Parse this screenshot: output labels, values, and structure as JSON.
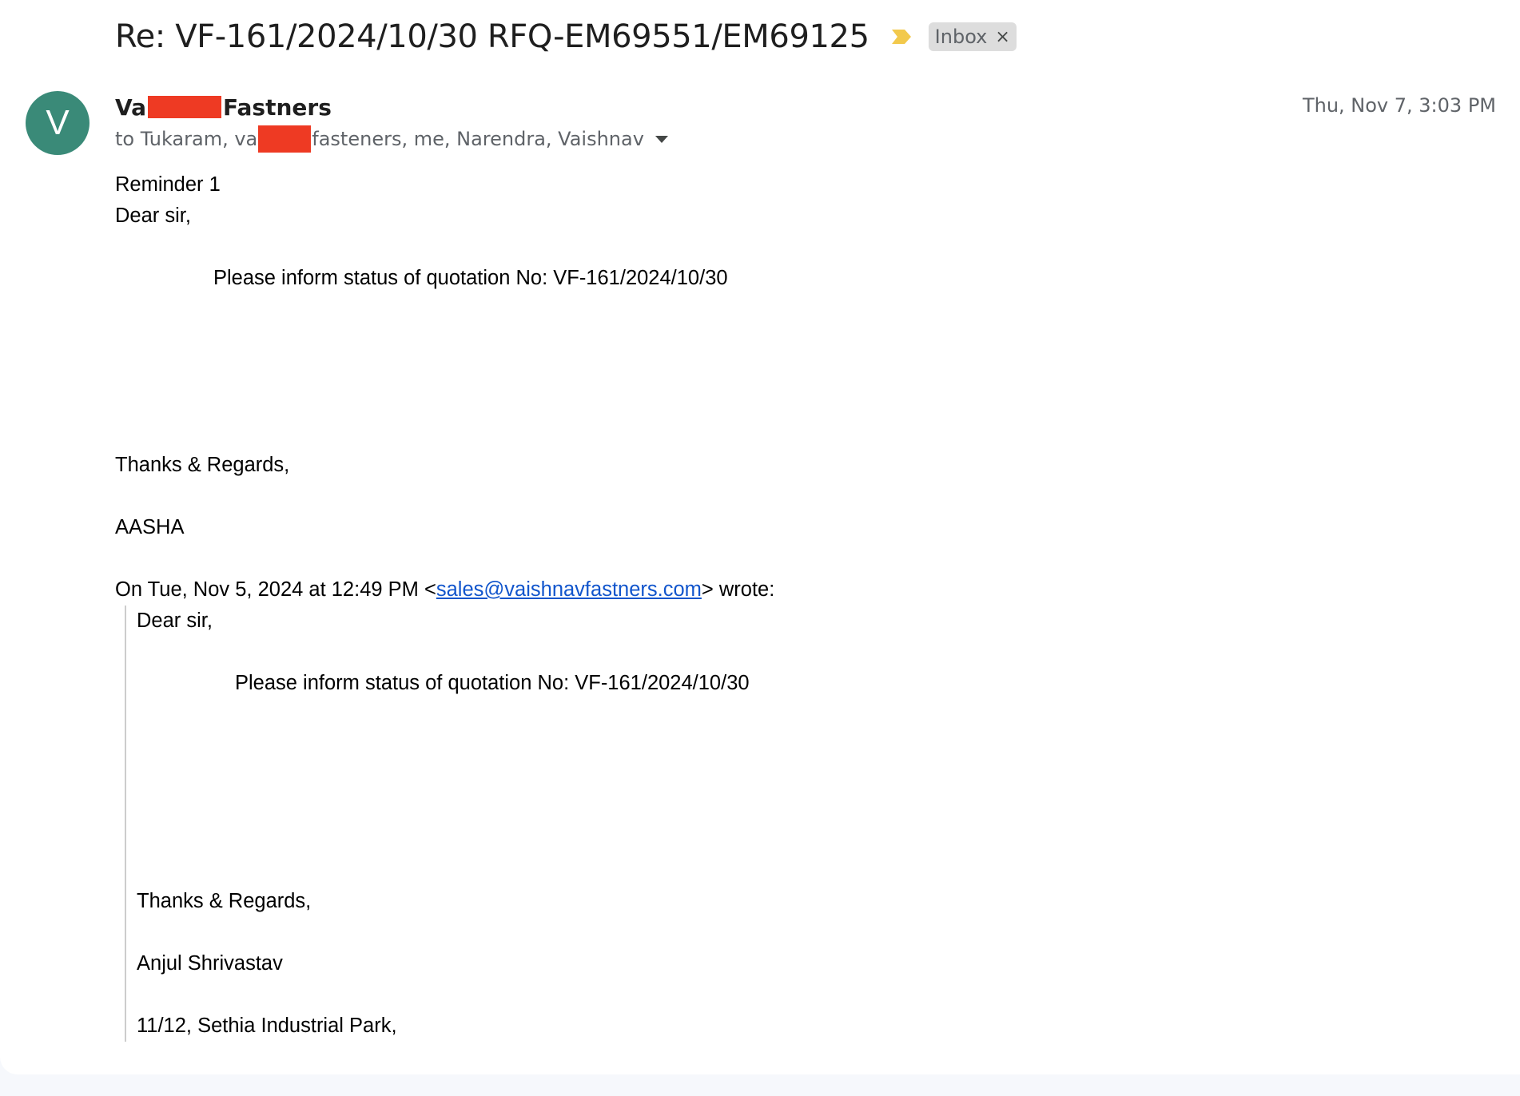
{
  "email": {
    "subject": "Re: VF-161/2024/10/30 RFQ-EM69551/EM69125",
    "label": "Inbox",
    "label_close": "×",
    "sender": {
      "avatar_letter": "V",
      "name_prefix": "Va",
      "name_suffix": "Fastners"
    },
    "date": "Thu, Nov 7, 3:03 PM",
    "recipients": {
      "before_redaction": "to Tukaram, va",
      "after_redaction": "fasteners, me, Narendra, Vaishnav"
    },
    "body": {
      "reminder": "Reminder 1",
      "greeting": "Dear sir,",
      "message": "Please inform status of quotation No:  VF-161/2024/10/30",
      "closing": "Thanks & Regards,",
      "signature": "AASHA"
    },
    "quote_header": {
      "prefix": "On Tue, Nov 5, 2024 at 12:49 PM <",
      "email": "sales@vaishnavfastners.com",
      "suffix": "> wrote:"
    },
    "quoted": {
      "greeting": "Dear sir,",
      "message": "Please inform status of quotation No:  VF-161/2024/10/30",
      "closing": "Thanks & Regards,",
      "signature": "Anjul Shrivastav",
      "address_line1": "11/12, Sethia Industrial Park,"
    }
  },
  "colors": {
    "avatar": "#3a8a78",
    "importance_marker": "#f2c94c",
    "redaction": "#ee3a23",
    "link": "#1155cc"
  },
  "icons": {
    "importance": "importance-marker-icon",
    "label_close": "close-icon",
    "details": "caret-down-icon"
  }
}
